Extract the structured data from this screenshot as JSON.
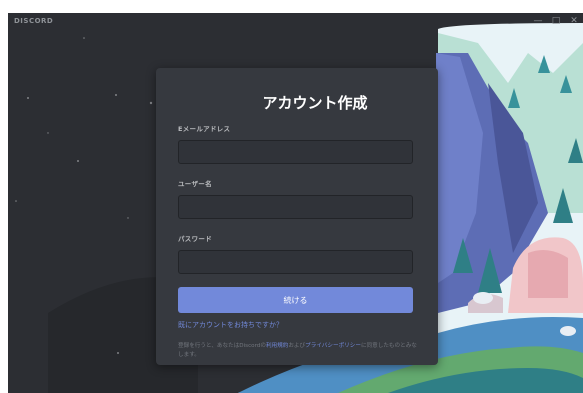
{
  "app": {
    "wordmark": "DISCORD",
    "window_controls": {
      "minimize": "—",
      "maximize": "□",
      "close": "✕"
    }
  },
  "register": {
    "title": "アカウント作成",
    "email_label": "Eメールアドレス",
    "email_value": "",
    "username_label": "ユーザー名",
    "username_value": "",
    "password_label": "パスワード",
    "password_value": "",
    "submit_label": "続ける",
    "login_link": "既にアカウントをお持ちですか？",
    "terms": {
      "prefix": "登録を行うと、あなたはDiscordの",
      "tos_link": "利用規約",
      "middle": "および",
      "privacy_link": "プライバシーポリシー",
      "suffix": "に同意したものとみなします。"
    }
  },
  "colors": {
    "window_bg": "#2b2d31",
    "modal_bg": "#36393f",
    "input_bg": "#303339",
    "accent": "#7289da",
    "label": "#b9bbbe"
  }
}
